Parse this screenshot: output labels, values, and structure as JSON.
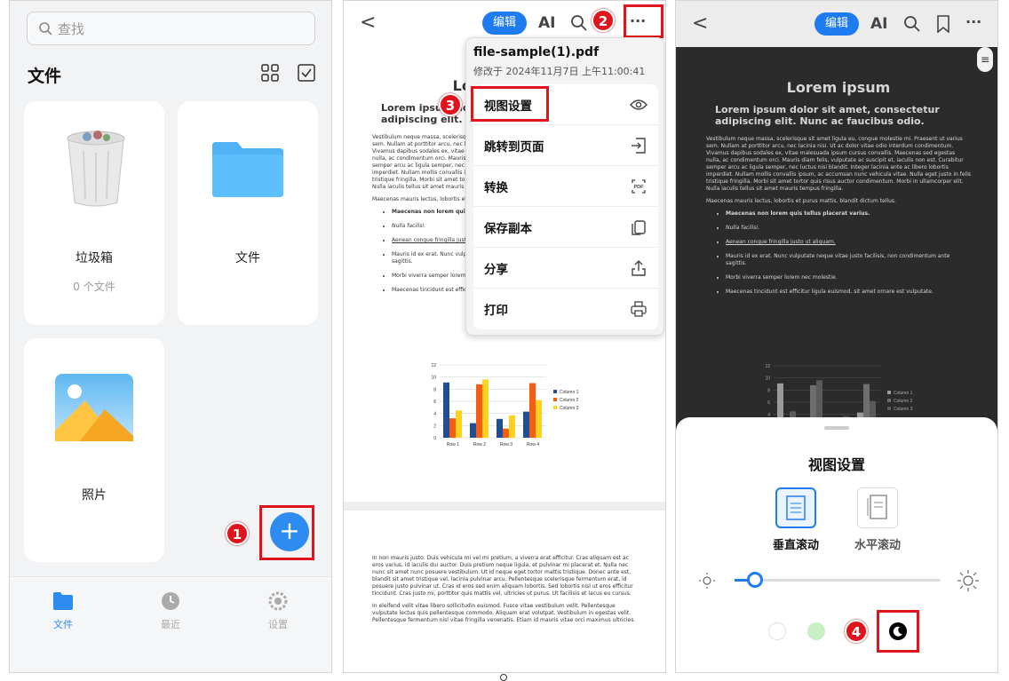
{
  "panel1": {
    "search_placeholder": "查找",
    "title": "文件",
    "cards": [
      {
        "label": "垃圾箱",
        "sub": "0 个文件"
      },
      {
        "label": "文件"
      },
      {
        "label": "照片"
      }
    ],
    "fab": "+",
    "badge1": "1",
    "tabs": [
      {
        "label": "文件",
        "active": true
      },
      {
        "label": "最近"
      },
      {
        "label": "设置"
      }
    ]
  },
  "panel2": {
    "back": "<",
    "edit": "编辑",
    "ai": "AI",
    "more": "···",
    "badge2": "2",
    "badge3": "3",
    "menu": {
      "filename": "file-sample(1).pdf",
      "modified": "修改于 2024年11月7日 上午11:00:41",
      "items": [
        {
          "label": "视图设置",
          "icon": "eye-icon"
        },
        {
          "label": "跳转到页面",
          "icon": "jump-icon"
        },
        {
          "label": "转换",
          "icon": "pdf-convert-icon"
        },
        {
          "label": "保存副本",
          "icon": "copy-icon"
        },
        {
          "label": "分享",
          "icon": "share-icon"
        },
        {
          "label": "打印",
          "icon": "print-icon"
        }
      ]
    },
    "doc": {
      "title": "Lorem ipsum",
      "heading": "Lorem ipsum dolor sit amet, consectetur adipiscing elit. Nunc ac faucibus odio.",
      "para1": "Vestibulum neque massa, scelerisque sit amet ligula eu, congue molestie mi. Praesent ut varius sem. Nullam at porttitor arcu, nec lacinia nisi. Ut ac dolor vitae odio interdum condimentum. Vivamus dapibus sodales ex, vitae malesuada ipsum cursus convallis. Maecenas sed egestas nulla, ac condimentum orci. Mauris diam felis, vulputate ac suscipit et, iaculis non est. Curabitur semper arcu ac ligula semper, nec luctus nisi blandit. Integer lacinia ante ac libero lobortis imperdiet. Nullam mollis convallis ipsum, ac accumsan nunc vehicula vitae. Nulla eget justo in felis tristique fringilla. Morbi sit amet tortor quis risus auctor condimentum. Morbi in ullamcorper elit. Nulla iaculis tellus sit amet mauris tempus fringilla.",
      "para2": "Maecenas mauris lectus, lobortis et purus mattis, blandit dictum tellus.",
      "bullets": [
        "Maecenas non lorem quis tellus placerat varius.",
        "Nulla facilisi.",
        "Aenean congue fringilla justo ut aliquam.",
        "Mauris id ex erat. Nunc vulputate neque vitae justo facilisis, non condimentum ante sagittis.",
        "Morbi viverra semper lorem nec molestie.",
        "Maecenas tincidunt est efficitur ligula euismod, sit amet ornare est vulputate."
      ],
      "para3": "In non mauris justo. Duis vehicula mi vel mi pretium, a viverra erat efficitur. Cras aliquam est ac eros varius, id iaculis dui auctor. Duis pretium neque ligula, et pulvinar mi placerat et. Nulla nec nunc sit amet nunc posuere vestibulum. Ut id neque eget tortor mattis tristique. Donec ante est, blandit sit amet tristique vel, lacinia pulvinar arcu. Pellentesque scelerisque fermentum erat, id posuere justo pulvinar ut. Cras id eros sed enim aliquam lobortis. Sed lobortis nisl ut eros efficitur tincidunt. Cras justo mi, porttitor quis mattis vel, ultricies ut purus. Ut facilisis et lacus eu cursus.",
      "para4": "In eleifend velit vitae libero sollicitudin euismod. Fusce vitae vestibulum velit. Pellentesque vulputate lectus quis pellentesque commodo. Aliquam erat volutpat. Vestibulum in egestas velit. Pellentesque fermentum nisl vitae fringilla venenatis. Etiam id mauris vitae orci maximus ultricies."
    }
  },
  "panel3": {
    "back": "<",
    "edit": "编辑",
    "ai": "AI",
    "sheet_title": "视图设置",
    "modes": [
      {
        "label": "垂直滚动",
        "selected": true
      },
      {
        "label": "水平滚动",
        "selected": false
      }
    ],
    "brightness": 0.1,
    "themes": [
      "#ffffff",
      "#c9efc5",
      "#000000"
    ],
    "badge4": "4"
  },
  "chart_data": {
    "type": "bar",
    "categories": [
      "Row 1",
      "Row 2",
      "Row 3",
      "Row 4"
    ],
    "series": [
      {
        "name": "Column 1",
        "values": [
          9.1,
          2.4,
          3.1,
          4.3
        ]
      },
      {
        "name": "Column 2",
        "values": [
          3.2,
          8.8,
          1.5,
          9.0
        ]
      },
      {
        "name": "Column 3",
        "values": [
          4.5,
          9.6,
          3.7,
          6.2
        ]
      }
    ],
    "ylim": [
      0,
      12
    ],
    "yticks": [
      0,
      2,
      4,
      6,
      8,
      10,
      12
    ],
    "legend": "right",
    "colors": [
      "#1f4e96",
      "#f55d13",
      "#ffd21f"
    ]
  }
}
